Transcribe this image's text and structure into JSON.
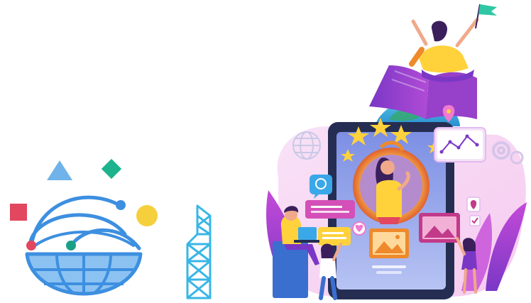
{
  "icons": {
    "globe_basket": "globe-basket-icon",
    "tower": "lattice-tower-icon",
    "triangle": "triangle-icon",
    "diamond": "diamond-icon",
    "square": "square-icon",
    "circle": "circle-icon",
    "tablet": "tablet-learning-illustration",
    "reader": "person-on-book-icon",
    "flag": "flag-icon",
    "globe": "globe-icon",
    "chart_card": "line-chart-card-icon",
    "chat_bubble": "chat-bubble-icon",
    "gear": "gear-icon",
    "image_card": "image-card-icon",
    "star": "star-icon",
    "location_pin": "location-pin-icon",
    "checkbox": "checkbox-icon",
    "heart": "heart-icon",
    "laptop": "laptop-icon"
  },
  "colors": {
    "globe_blue": "#3d8fe0",
    "globe_light": "#8cc2f2",
    "tower_blue": "#38b6e6",
    "triangle_blue": "#6fb3ea",
    "diamond_green": "#1db38d",
    "square_red": "#e2475f",
    "circle_yellow": "#f6cf3c",
    "dot_red": "#e2475f",
    "dot_green": "#1a9f87",
    "dot_blue": "#3d8fe0",
    "tablet_frame": "#252e52",
    "tablet_screen": "#8c9fe6",
    "purple": "#7a37c6",
    "pink": "#f07ad0",
    "orange": "#ee8a2b",
    "yellow": "#ffd23c"
  }
}
